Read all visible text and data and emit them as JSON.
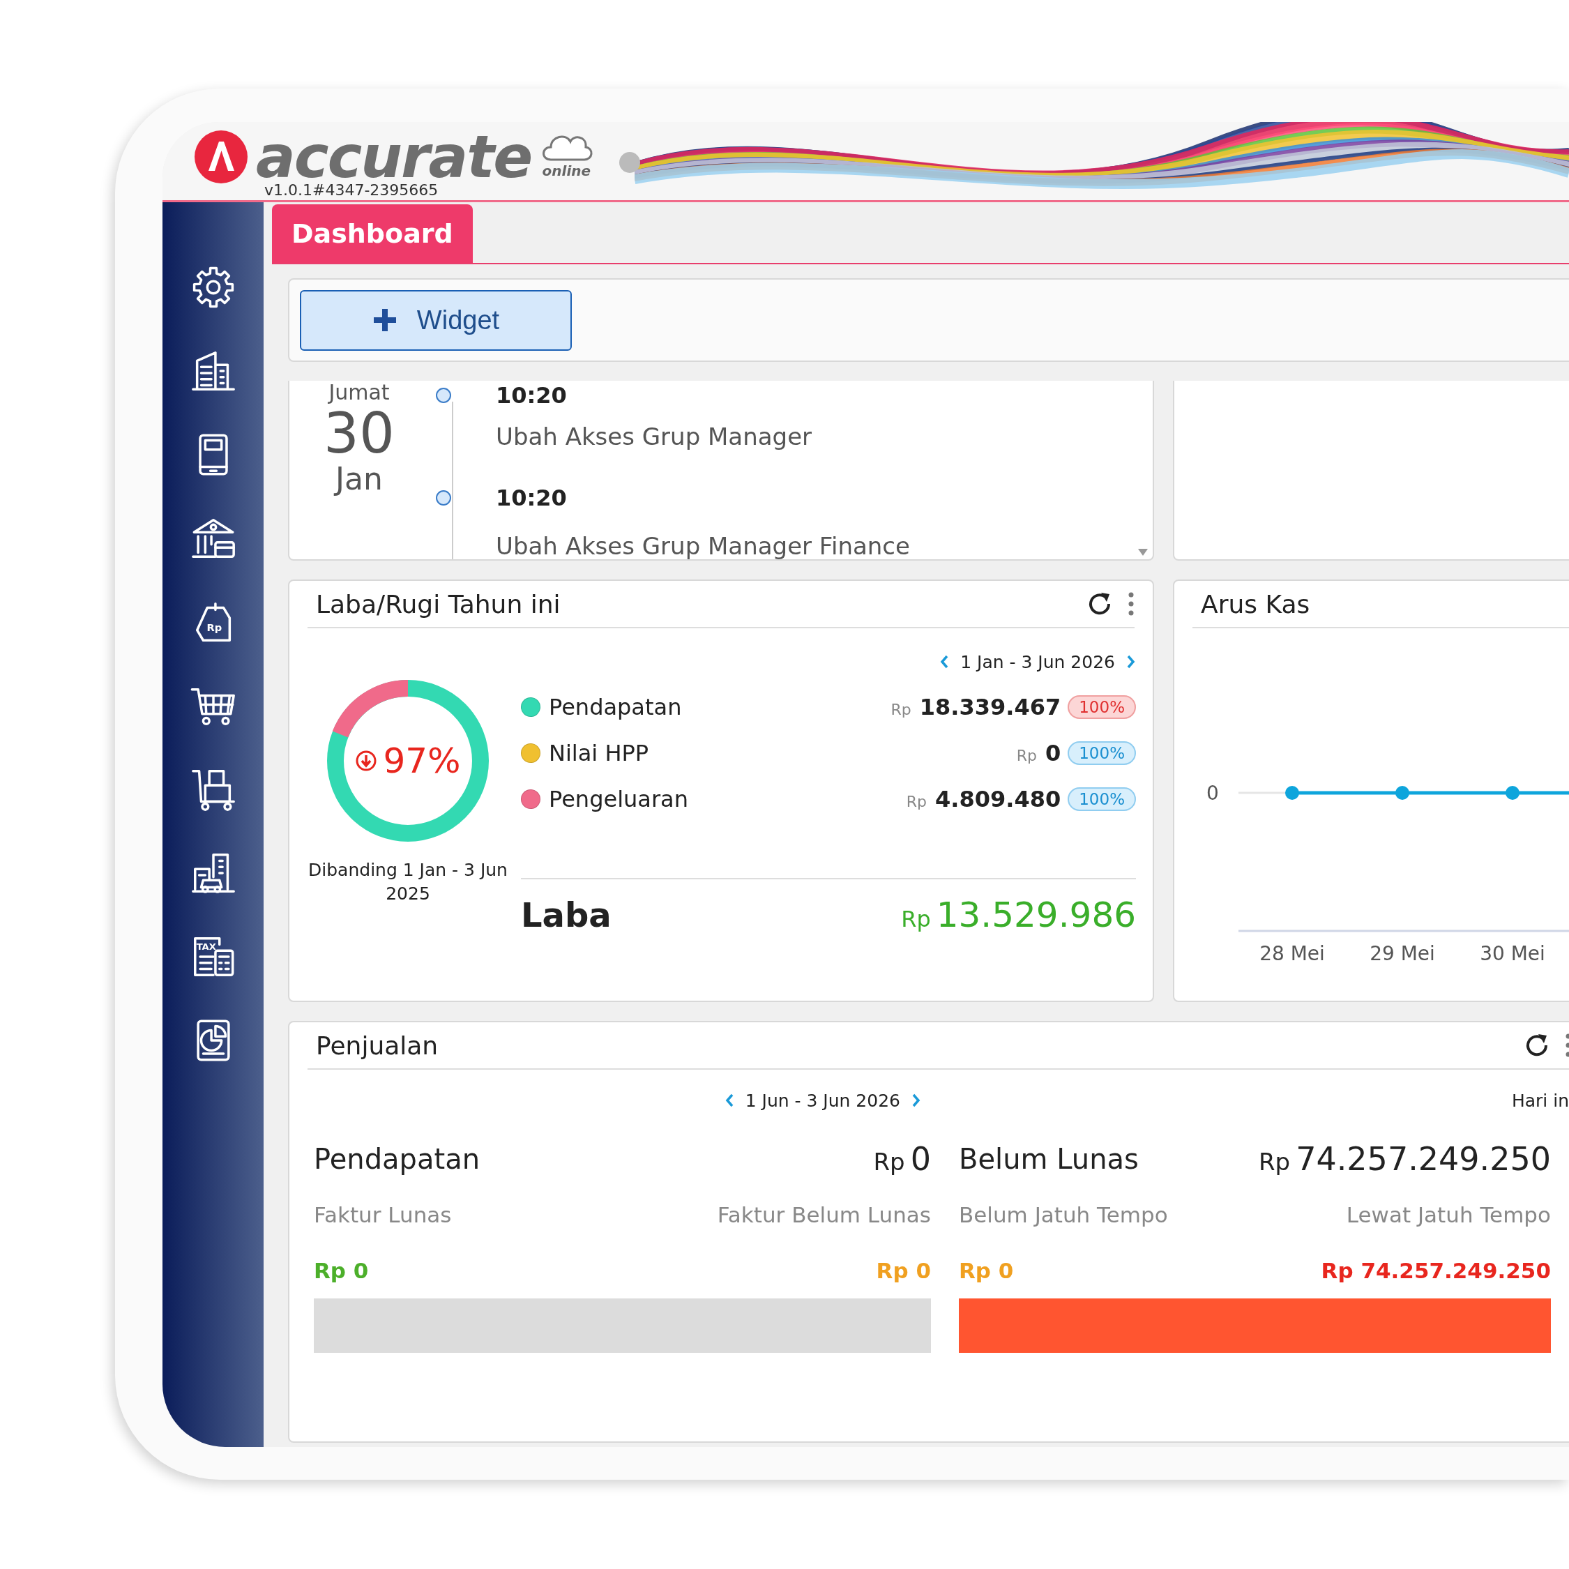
{
  "header": {
    "logo_text": "accurate",
    "logo_sub": "online",
    "version": "v1.0.1#4347-2395665"
  },
  "sidebar": {
    "items": [
      {
        "kind": "settings"
      },
      {
        "kind": "company"
      },
      {
        "kind": "ledger"
      },
      {
        "kind": "bank"
      },
      {
        "kind": "sales-tag",
        "icon_text": "Rp"
      },
      {
        "kind": "cart"
      },
      {
        "kind": "trolley"
      },
      {
        "kind": "assets"
      },
      {
        "kind": "tax",
        "icon_text": "TAX"
      },
      {
        "kind": "report"
      }
    ]
  },
  "tabs": [
    {
      "label": "Dashboard",
      "selected": true
    }
  ],
  "toolbar": {
    "add_button": "Widget"
  },
  "activity": {
    "day_name": "Jumat",
    "day": "30",
    "month": "Jan",
    "entries": [
      {
        "time": "10:20",
        "text": "Ubah Akses Grup Manager"
      },
      {
        "time": "10:20",
        "text": "Ubah Akses Grup Manager Finance"
      }
    ]
  },
  "profit_loss": {
    "title": "Laba/Rugi Tahun ini",
    "period": "1 Jan - 3 Jun 2026",
    "change": "97%",
    "decrease": true,
    "comparison": "Dibanding 1 Jan - 3 Jun 2025",
    "rows": [
      {
        "label": "Pendapatan",
        "color": "#33d9b2",
        "currency": "Rp",
        "amount": "18.339.467",
        "badge": "100%",
        "alert": true
      },
      {
        "label": "Nilai HPP",
        "color": "#f0c030",
        "currency": "Rp",
        "amount": "0",
        "badge": "100%",
        "alert": false
      },
      {
        "label": "Pengeluaran",
        "color": "#f06a8a",
        "currency": "Rp",
        "amount": "4.809.480",
        "badge": "100%",
        "alert": false
      }
    ],
    "total": {
      "label": "Laba",
      "currency": "Rp",
      "amount": "13.529.986"
    }
  },
  "cash_flow": {
    "title": "Arus Kas",
    "y_label": "0",
    "x_labels": [
      "28 Mei",
      "29 Mei",
      "30 Mei"
    ]
  },
  "sales": {
    "title": "Penjualan",
    "period": "1 Jun - 3 Jun 2026",
    "today": "Hari in",
    "groups": [
      {
        "title": "Pendapatan",
        "currency": "Rp",
        "amount": "0",
        "left": {
          "label": "Faktur Lunas",
          "value": "Rp 0",
          "color": "#4caf2a"
        },
        "right": {
          "label": "Faktur Belum Lunas",
          "value": "Rp 0",
          "color": "#f0a020"
        },
        "level": 0
      },
      {
        "title": "Belum Lunas",
        "currency": "Rp",
        "amount": "74.257.249.250",
        "left": {
          "label": "Belum Jatuh Tempo",
          "value": "Rp 0",
          "color": "#f0a020"
        },
        "right": {
          "label": "Lewat Jatuh Tempo",
          "value": "Rp 74.257.249.250",
          "color": "#e8261e"
        },
        "level": 1
      }
    ]
  }
}
